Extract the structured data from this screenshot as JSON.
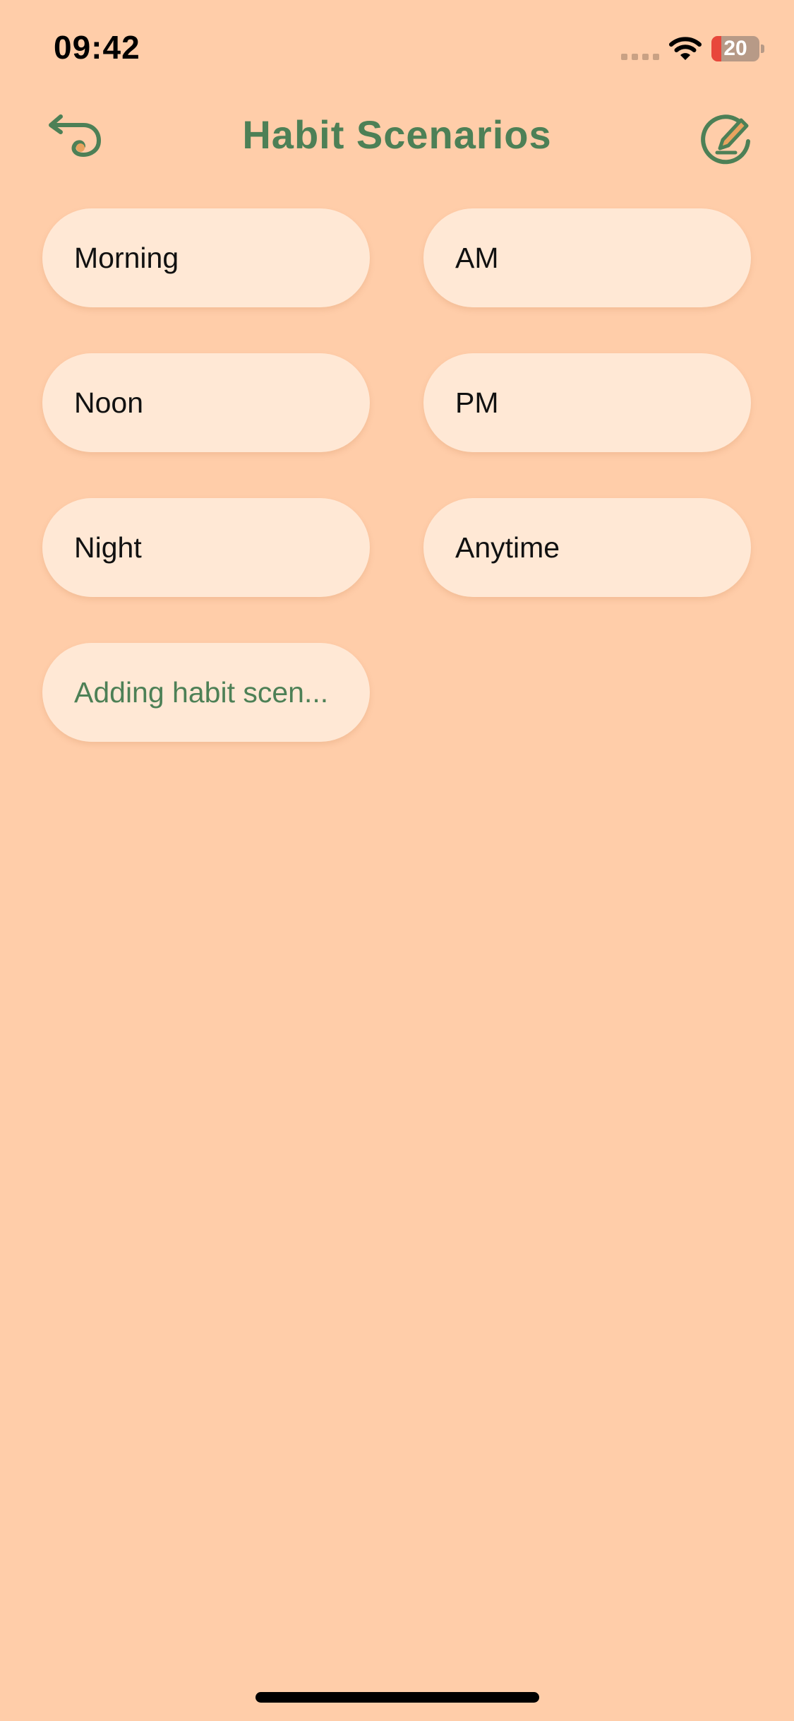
{
  "status_bar": {
    "time": "09:42",
    "battery_level": "20",
    "battery_fraction": 0.2
  },
  "nav": {
    "title": "Habit Scenarios",
    "back_icon": "back-arrow-icon",
    "edit_icon": "edit-pencil-icon"
  },
  "scenarios": [
    {
      "label": "Morning"
    },
    {
      "label": "AM"
    },
    {
      "label": "Noon"
    },
    {
      "label": "PM"
    },
    {
      "label": "Night"
    },
    {
      "label": "Anytime"
    }
  ],
  "add_scenario": {
    "label": "Adding habit scen..."
  },
  "colors": {
    "background": "#FFCDA9",
    "chip": "#FFE8D5",
    "accent": "#4D8056",
    "battery_low": "#E8473B"
  }
}
